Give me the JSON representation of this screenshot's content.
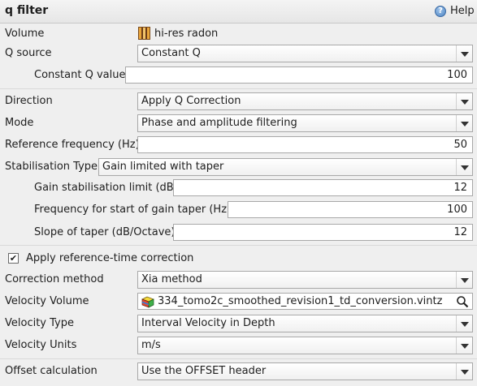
{
  "header": {
    "title": "q filter",
    "help_label": "Help"
  },
  "volume": {
    "label": "Volume",
    "value": "hi-res radon"
  },
  "q_source": {
    "label": "Q source",
    "value": "Constant Q"
  },
  "constant_q": {
    "label": "Constant Q value",
    "value": "100"
  },
  "direction": {
    "label": "Direction",
    "value": "Apply Q Correction"
  },
  "mode": {
    "label": "Mode",
    "value": "Phase and amplitude filtering"
  },
  "reference_frequency": {
    "label": "Reference frequency (Hz)",
    "value": "50"
  },
  "stabilisation_type": {
    "label": "Stabilisation Type",
    "value": "Gain limited with taper"
  },
  "gain_limit": {
    "label": "Gain stabilisation limit (dB)",
    "value": "12"
  },
  "taper_start": {
    "label": "Frequency for start of gain taper (Hz)",
    "value": "100"
  },
  "taper_slope": {
    "label": "Slope of taper (dB/Octave)",
    "value": "12"
  },
  "apply_ref_time": {
    "label": "Apply reference-time correction",
    "checked": true,
    "check_glyph": "✔"
  },
  "correction_method": {
    "label": "Correction method",
    "value": "Xia method"
  },
  "velocity_volume": {
    "label": "Velocity Volume",
    "value": "334_tomo2c_smoothed_revision1_td_conversion.vintz"
  },
  "velocity_type": {
    "label": "Velocity Type",
    "value": "Interval Velocity in Depth"
  },
  "velocity_units": {
    "label": "Velocity Units",
    "value": "m/s"
  },
  "offset_calculation": {
    "label": "Offset calculation",
    "value": "Use the OFFSET header"
  }
}
